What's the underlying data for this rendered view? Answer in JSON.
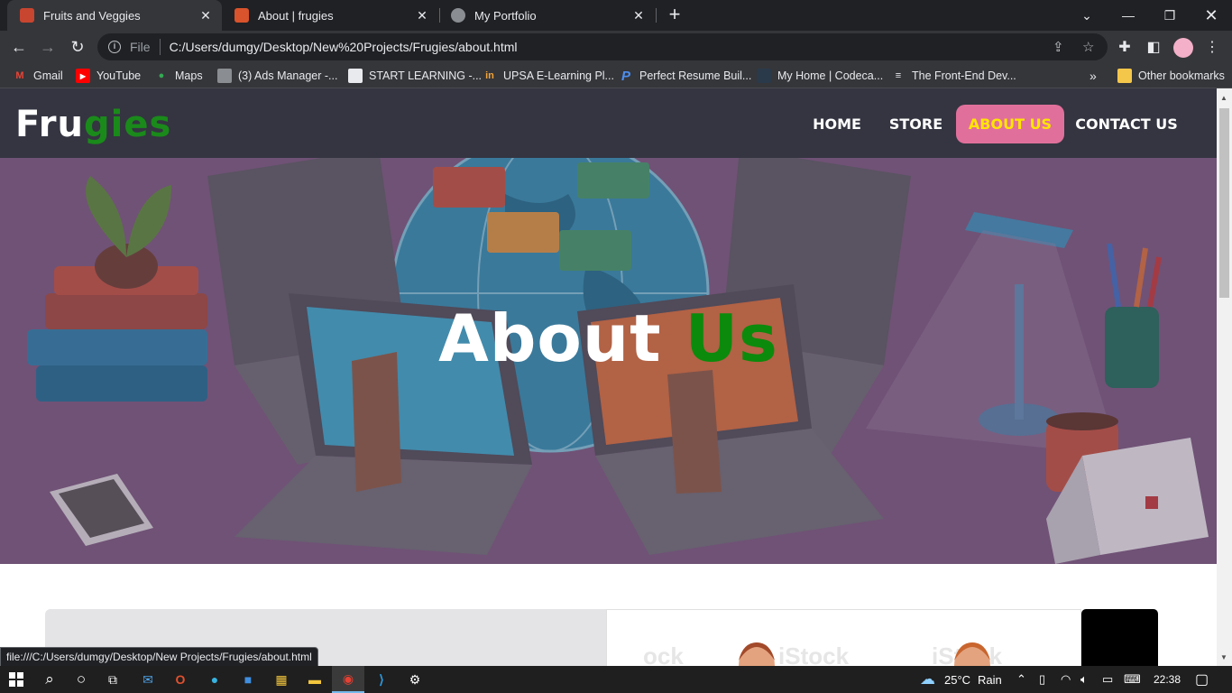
{
  "browser": {
    "tabs": [
      {
        "title": "Fruits and Veggies",
        "active": true
      },
      {
        "title": "About | frugies",
        "active": false
      },
      {
        "title": "My Portfolio",
        "active": false
      }
    ],
    "url": {
      "scheme": "File",
      "path": "C:/Users/dumgy/Desktop/New%20Projects/Frugies/about.html"
    },
    "bookmarks": [
      {
        "label": "Gmail",
        "icon": "gmail-icon"
      },
      {
        "label": "YouTube",
        "icon": "youtube-icon"
      },
      {
        "label": "Maps",
        "icon": "maps-icon"
      },
      {
        "label": "(3) Ads Manager -...",
        "icon": "ads-manager-icon"
      },
      {
        "label": "START LEARNING -...",
        "icon": "start-learning-icon"
      },
      {
        "label": "UPSA E-Learning Pl...",
        "icon": "upsa-icon"
      },
      {
        "label": "Perfect Resume Buil...",
        "icon": "resume-icon"
      },
      {
        "label": "My Home | Codeca...",
        "icon": "codecademy-icon"
      },
      {
        "label": "The Front-End Dev...",
        "icon": "frontend-icon"
      }
    ],
    "other_bookmarks": "Other bookmarks",
    "status_url": "file:///C:/Users/dumgy/Desktop/New Projects/Frugies/about.html"
  },
  "site": {
    "logo": {
      "main": "Fru",
      "accent": "gies"
    },
    "nav": [
      "HOME",
      "STORE",
      "ABOUT US",
      "CONTACT US"
    ],
    "active_nav": "ABOUT US",
    "hero": {
      "title_main": "About",
      "title_accent": "Us"
    },
    "watermarks": [
      "ock",
      "iStock",
      "iStock"
    ]
  },
  "taskbar": {
    "weather": {
      "temp": "25°C",
      "condition": "Rain"
    },
    "time": "22:38"
  },
  "colors": {
    "site_nav_bg": "#343541",
    "logo_accent": "#1a8a1a",
    "active_nav_bg": "#e0709b",
    "active_nav_text": "#ffe600",
    "hero_tint": "#7b5a80"
  }
}
